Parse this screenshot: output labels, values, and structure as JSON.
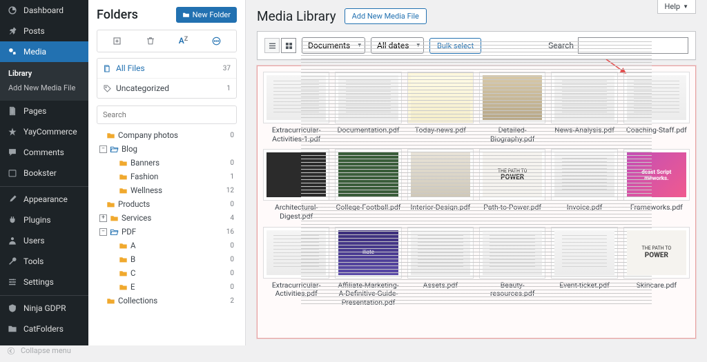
{
  "help": "Help",
  "wp_menu": {
    "dashboard": "Dashboard",
    "posts": "Posts",
    "media": "Media",
    "library": "Library",
    "add_new_media": "Add New Media File",
    "pages": "Pages",
    "yaycommerce": "YayCommerce",
    "comments": "Comments",
    "bookster": "Bookster",
    "appearance": "Appearance",
    "plugins": "Plugins",
    "users": "Users",
    "tools": "Tools",
    "settings": "Settings",
    "ninja_gdpr": "Ninja GDPR",
    "catfolders": "CatFolders",
    "collapse": "Collapse menu"
  },
  "folders": {
    "title": "Folders",
    "new_btn": "New Folder",
    "all_files": "All Files",
    "all_files_count": "37",
    "uncategorized": "Uncategorized",
    "uncategorized_count": "1",
    "search_ph": "Search",
    "tree": {
      "company_photos": "Company photos",
      "company_photos_c": "0",
      "blog": "Blog",
      "banners": "Banners",
      "banners_c": "0",
      "fashion": "Fashion",
      "fashion_c": "1",
      "wellness": "Wellness",
      "wellness_c": "12",
      "products": "Products",
      "products_c": "0",
      "services": "Services",
      "services_c": "4",
      "pdf": "PDF",
      "pdf_c": "16",
      "a": "A",
      "a_c": "0",
      "b": "B",
      "b_c": "0",
      "c": "C",
      "c_c": "0",
      "e": "E",
      "e_c": "0",
      "collections": "Collections",
      "collections_c": "2"
    }
  },
  "main": {
    "title": "Media Library",
    "add_new": "Add New Media File",
    "filter_type": "Documents",
    "filter_date": "All dates",
    "bulk": "Bulk select",
    "search_label": "Search",
    "power_text": "THE PATH TO POWER",
    "frameworks_text": "dcast Script meworks.",
    "files": [
      {
        "name": "Extracurricular-Activities-1.pdf",
        "thumb": "lines"
      },
      {
        "name": "Documentation.pdf",
        "thumb": "lines"
      },
      {
        "name": "Today-news.pdf",
        "thumb": "news"
      },
      {
        "name": "Detailed-Biography.pdf",
        "thumb": "photo"
      },
      {
        "name": "News-Analysis.pdf",
        "thumb": "lines"
      },
      {
        "name": "Coaching-Staff.pdf",
        "thumb": "lines"
      },
      {
        "name": "Architectural-Digest.pdf",
        "thumb": "dark"
      },
      {
        "name": "College-Football.pdf",
        "thumb": "green"
      },
      {
        "name": "Interior-Design.pdf",
        "thumb": "room"
      },
      {
        "name": "Path-to-Power.pdf",
        "thumb": "power"
      },
      {
        "name": "Invoice.pdf",
        "thumb": "lines"
      },
      {
        "name": "Frameworks.pdf",
        "thumb": "pink"
      },
      {
        "name": "Extracurricular-Activities.pdf",
        "thumb": "lines"
      },
      {
        "name": "Affiliate-Marketing-A-Definitive-Guide-Presentation.pdf",
        "thumb": "purple"
      },
      {
        "name": "Assets.pdf",
        "thumb": "lines"
      },
      {
        "name": "Beauty-resources.pdf",
        "thumb": "lines"
      },
      {
        "name": "Event-ticket.pdf",
        "thumb": "lines"
      },
      {
        "name": "Skincare.pdf",
        "thumb": "power"
      }
    ]
  }
}
